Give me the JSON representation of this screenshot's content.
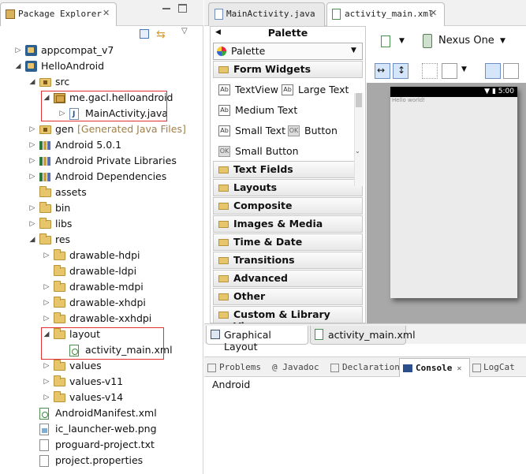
{
  "package_explorer": {
    "title": "Package Explorer",
    "close": "✕",
    "tree": [
      {
        "label": "appcompat_v7",
        "icon": "project-icon",
        "depth": 0,
        "twisty": ">"
      },
      {
        "label": "HelloAndroid",
        "icon": "project-icon",
        "depth": 0,
        "twisty": "v"
      },
      {
        "label": "src",
        "icon": "source-folder-icon",
        "depth": 1,
        "twisty": "v"
      },
      {
        "label": "me.gacl.helloandroid",
        "icon": "package-icon",
        "depth": 2,
        "twisty": "v"
      },
      {
        "label": "MainActivity.java",
        "icon": "java-file-icon",
        "depth": 3,
        "twisty": ">"
      },
      {
        "label": "gen",
        "decoration": "[Generated Java Files]",
        "icon": "source-folder-icon",
        "depth": 1,
        "twisty": ">"
      },
      {
        "label": "Android 5.0.1",
        "icon": "library-icon",
        "depth": 1,
        "twisty": ">"
      },
      {
        "label": "Android Private Libraries",
        "icon": "library-icon",
        "depth": 1,
        "twisty": ">"
      },
      {
        "label": "Android Dependencies",
        "icon": "library-icon",
        "depth": 1,
        "twisty": ">"
      },
      {
        "label": "assets",
        "icon": "folder-icon",
        "depth": 1,
        "twisty": ""
      },
      {
        "label": "bin",
        "icon": "folder-icon",
        "depth": 1,
        "twisty": ">"
      },
      {
        "label": "libs",
        "icon": "folder-icon",
        "depth": 1,
        "twisty": ">"
      },
      {
        "label": "res",
        "icon": "folder-icon",
        "depth": 1,
        "twisty": "v"
      },
      {
        "label": "drawable-hdpi",
        "icon": "folder-icon",
        "depth": 2,
        "twisty": ">"
      },
      {
        "label": "drawable-ldpi",
        "icon": "folder-icon",
        "depth": 2,
        "twisty": ""
      },
      {
        "label": "drawable-mdpi",
        "icon": "folder-icon",
        "depth": 2,
        "twisty": ">"
      },
      {
        "label": "drawable-xhdpi",
        "icon": "folder-icon",
        "depth": 2,
        "twisty": ">"
      },
      {
        "label": "drawable-xxhdpi",
        "icon": "folder-icon",
        "depth": 2,
        "twisty": ">"
      },
      {
        "label": "layout",
        "icon": "folder-icon",
        "depth": 2,
        "twisty": "v"
      },
      {
        "label": "activity_main.xml",
        "icon": "xml-file-icon",
        "depth": 3,
        "twisty": ""
      },
      {
        "label": "values",
        "icon": "folder-icon",
        "depth": 2,
        "twisty": ">"
      },
      {
        "label": "values-v11",
        "icon": "folder-icon",
        "depth": 2,
        "twisty": ">"
      },
      {
        "label": "values-v14",
        "icon": "folder-icon",
        "depth": 2,
        "twisty": ">"
      },
      {
        "label": "AndroidManifest.xml",
        "icon": "xml-file-icon",
        "depth": 1,
        "twisty": ""
      },
      {
        "label": "ic_launcher-web.png",
        "icon": "png-file-icon",
        "depth": 1,
        "twisty": ""
      },
      {
        "label": "proguard-project.txt",
        "icon": "text-file-icon",
        "depth": 1,
        "twisty": ""
      },
      {
        "label": "project.properties",
        "icon": "text-file-icon",
        "depth": 1,
        "twisty": ""
      }
    ]
  },
  "editor": {
    "tabs": [
      {
        "label": "MainActivity.java",
        "active": false
      },
      {
        "label": "activity_main.xml",
        "active": true,
        "close": "✕"
      }
    ],
    "palette": {
      "title": "Palette",
      "selector": "Palette",
      "categories": [
        {
          "label": "Form Widgets",
          "expanded": true
        },
        {
          "label": "Text Fields"
        },
        {
          "label": "Layouts"
        },
        {
          "label": "Composite"
        },
        {
          "label": "Images & Media"
        },
        {
          "label": "Time & Date"
        },
        {
          "label": "Transitions"
        },
        {
          "label": "Advanced"
        },
        {
          "label": "Other"
        },
        {
          "label": "Custom & Library Views"
        }
      ],
      "widgets": [
        {
          "label": "TextView",
          "icon": "Ab"
        },
        {
          "label": "Large Text",
          "icon": "Ab"
        },
        {
          "label": "Medium Text",
          "icon": "Ab"
        },
        {
          "label": "Small Text",
          "icon": "Ab"
        },
        {
          "label": "Button",
          "icon": "OK"
        },
        {
          "label": "Small Button",
          "icon": "OK"
        }
      ]
    },
    "device": "Nexus One",
    "status_time": "5:00",
    "preview_text": "Hello world!",
    "bottom_tabs": [
      {
        "label": "Graphical Layout",
        "active": true
      },
      {
        "label": "activity_main.xml",
        "active": false
      }
    ]
  },
  "console": {
    "tabs": [
      {
        "label": "Problems",
        "active": false
      },
      {
        "label": "@ Javadoc",
        "active": false
      },
      {
        "label": "Declaration",
        "active": false
      },
      {
        "label": "Console",
        "active": true,
        "close": "✕"
      },
      {
        "label": "LogCat",
        "active": false
      }
    ],
    "text": "Android"
  }
}
